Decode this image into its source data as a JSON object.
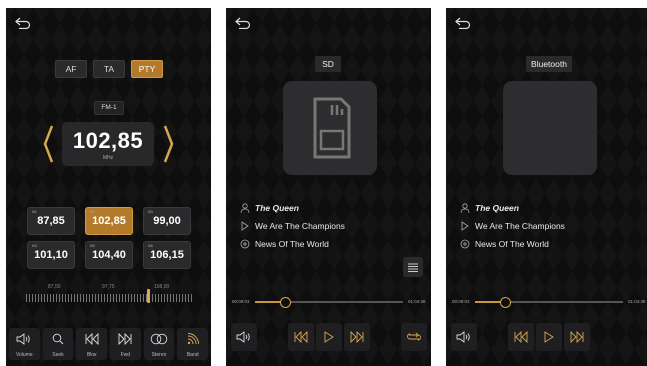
{
  "radio": {
    "toggles": [
      {
        "label": "AF",
        "active": false
      },
      {
        "label": "TA",
        "active": false
      },
      {
        "label": "PTY",
        "active": true
      }
    ],
    "band": "FM-1",
    "frequency": "102,85",
    "unit": "MHz",
    "presets": [
      {
        "num": "M1",
        "value": "87,85",
        "active": false
      },
      {
        "num": "M2",
        "value": "102,85",
        "active": true
      },
      {
        "num": "M3",
        "value": "99,00",
        "active": false
      },
      {
        "num": "M4",
        "value": "101,10",
        "active": false
      },
      {
        "num": "M5",
        "value": "104,40",
        "active": false
      },
      {
        "num": "M6",
        "value": "106,15",
        "active": false
      }
    ],
    "dial_labels": [
      "87,50",
      "97,75",
      "108,00"
    ],
    "dial_fraction": 0.73,
    "controls": [
      {
        "label": "Volume",
        "icon": "volume-icon"
      },
      {
        "label": "Seek",
        "icon": "search-icon"
      },
      {
        "label": "Bkw",
        "icon": "skip-back-icon"
      },
      {
        "label": "Fwd",
        "icon": "skip-forward-icon"
      },
      {
        "label": "Stereo",
        "icon": "stereo-icon"
      },
      {
        "label": "Band",
        "icon": "signal-icon"
      }
    ]
  },
  "sd": {
    "source_label": "SD",
    "artist": "The Queen",
    "track": "We Are The Champions",
    "album": "News Of The World",
    "time_elapsed": "00:09:03",
    "time_total": "01:04:38",
    "progress_fraction": 0.2
  },
  "bluetooth": {
    "source_label": "Bluetooth",
    "artist": "The Queen",
    "track": "We Are The Champions",
    "album": "News Of The World",
    "time_elapsed": "00:09:03",
    "time_total": "01:04:38",
    "progress_fraction": 0.2
  },
  "colors": {
    "accent": "#b47a2b",
    "accent_light": "#d6a653",
    "background": "#0e0e0f",
    "panel": "#2a2a2c"
  }
}
